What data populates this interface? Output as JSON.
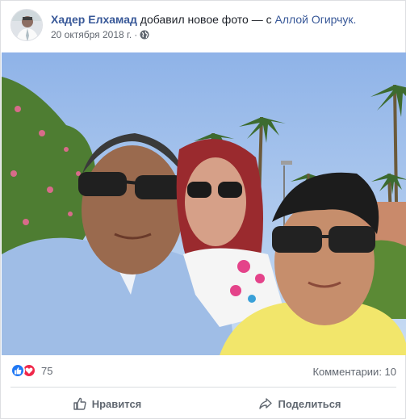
{
  "post": {
    "author": "Хадер Елхамад",
    "action_text": "добавил новое фото — с",
    "tagged_user": "Аллой Огирчук.",
    "date": "20 октября 2018 г.",
    "date_separator": "·",
    "privacy_icon": "globe-icon"
  },
  "photo": {
    "description_icon": "family-selfie-photo"
  },
  "stats": {
    "reaction_icons": [
      "like-icon",
      "love-icon"
    ],
    "reaction_count": "75",
    "comments_label": "Комментарии: 10"
  },
  "actions": {
    "like_label": "Нравится",
    "share_label": "Поделиться"
  },
  "colors": {
    "link_blue": "#385898",
    "like_blue": "#2078f4",
    "love_red": "#f0284a",
    "muted_text": "#616770"
  }
}
